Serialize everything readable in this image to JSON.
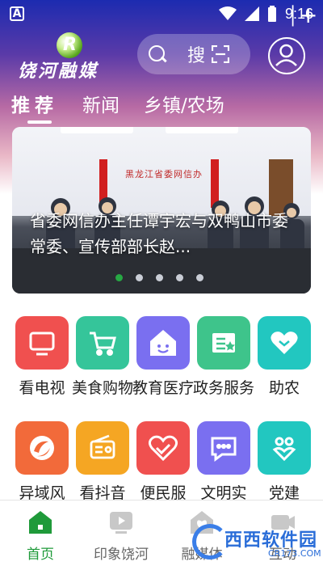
{
  "status_bar": {
    "left_icon": "A",
    "time": "9:16"
  },
  "logo": {
    "mark": "R",
    "text": "饶河融媒"
  },
  "search": {
    "label": "搜"
  },
  "tabs": [
    {
      "label": "推荐",
      "active": true
    },
    {
      "label": "新闻",
      "active": false
    },
    {
      "label": "乡镇/农场",
      "active": false
    },
    {
      "label": "│",
      "active": false
    }
  ],
  "tab_plus": "+",
  "banner": {
    "sign_text": "黑龙江省委网信办",
    "caption": "省委网信办主任谭宇宏与双鸭山市委常委、宣传部部长赵...",
    "total_slides": 5,
    "active_slide": 1
  },
  "grid": [
    {
      "label": "看电视",
      "icon": "tv-icon",
      "color": "#f0504f"
    },
    {
      "label": "美食购物",
      "icon": "shopping-cart-icon",
      "color": "#35c59a"
    },
    {
      "label": "教育医疗",
      "icon": "house-smile-icon",
      "color": "#7a6ff0"
    },
    {
      "label": "政务服务",
      "icon": "certificate-icon",
      "color": "#3ec48b"
    },
    {
      "label": "助农",
      "icon": "heart-icon",
      "color": "#22c7c0"
    },
    {
      "label": "异域风",
      "icon": "camera-lens-icon",
      "color": "#f26a3a"
    },
    {
      "label": "看抖音",
      "icon": "radio-icon",
      "color": "#f5a623"
    },
    {
      "label": "便民服",
      "icon": "handshake-heart-icon",
      "color": "#f0504f"
    },
    {
      "label": "文明实",
      "icon": "chat-bubble-icon",
      "color": "#7a6ff0"
    },
    {
      "label": "党建",
      "icon": "people-heart-icon",
      "color": "#22c7c0"
    }
  ],
  "bottom_nav": [
    {
      "label": "首页",
      "icon": "home-icon",
      "active": true
    },
    {
      "label": "印象饶河",
      "icon": "play-video-icon",
      "active": false
    },
    {
      "label": "融媒体",
      "icon": "media-house-icon",
      "active": false
    },
    {
      "label": "互动",
      "icon": "camera-icon",
      "active": false
    }
  ],
  "watermark": {
    "text": "西西软件园",
    "sub": "CR173.COM"
  },
  "colors": {
    "accent_green": "#27a844",
    "header_top": "#1c2bb0",
    "header_mid": "#b76aa4"
  }
}
